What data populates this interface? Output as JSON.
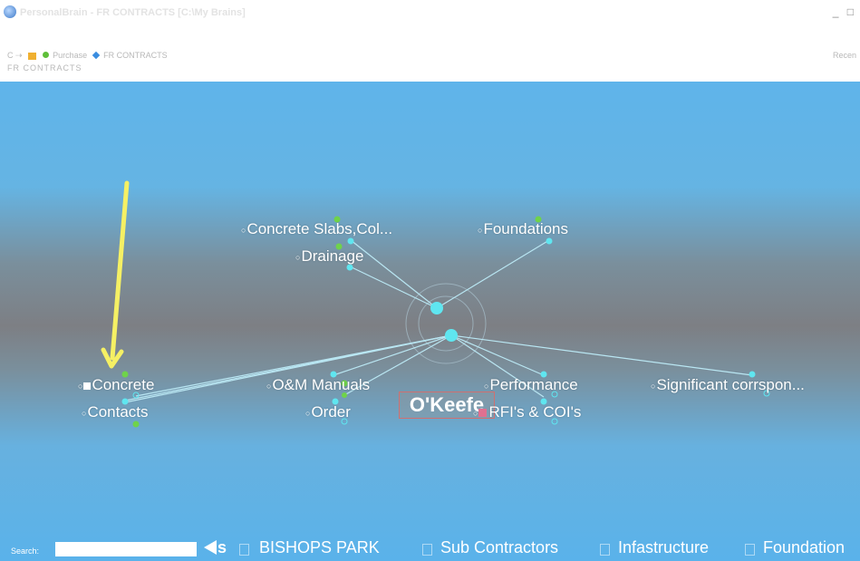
{
  "window": {
    "title": "PersonalBrain - FR CONTRACTS [C:\\My Brains]",
    "controls": "_ □"
  },
  "toolbar": {
    "nav_text": "C",
    "nav_item_1": "Purchase",
    "nav_item_2": "FR CONTRACTS",
    "path": "FR  CONTRACTS",
    "recent": "Recen"
  },
  "plex": {
    "central_thought": "O'Keefe",
    "parents": [
      {
        "label": "Concrete Slabs,Col..."
      },
      {
        "label": "Foundations"
      },
      {
        "label": "Drainage"
      }
    ],
    "children": [
      {
        "label": "Concrete"
      },
      {
        "label": "O&M Manuals"
      },
      {
        "label": "Performance"
      },
      {
        "label": "Significant corrspon..."
      },
      {
        "label": "Contacts"
      },
      {
        "label": "Order"
      },
      {
        "label": "RFI's & COI's"
      }
    ],
    "colors": {
      "sky_top": "#5fb4ea",
      "horizon": "#7d7f84",
      "node_dot": "#5fe6f0",
      "highlight_dot": "#6fd34a",
      "annotation_arrow": "#f5f064"
    }
  },
  "bottom": {
    "search_label": "Search:",
    "search_value": "",
    "back_label": "s",
    "crumbs": [
      "BISHOPS PARK",
      "Sub Contractors",
      "Infastructure",
      "Foundation"
    ]
  }
}
